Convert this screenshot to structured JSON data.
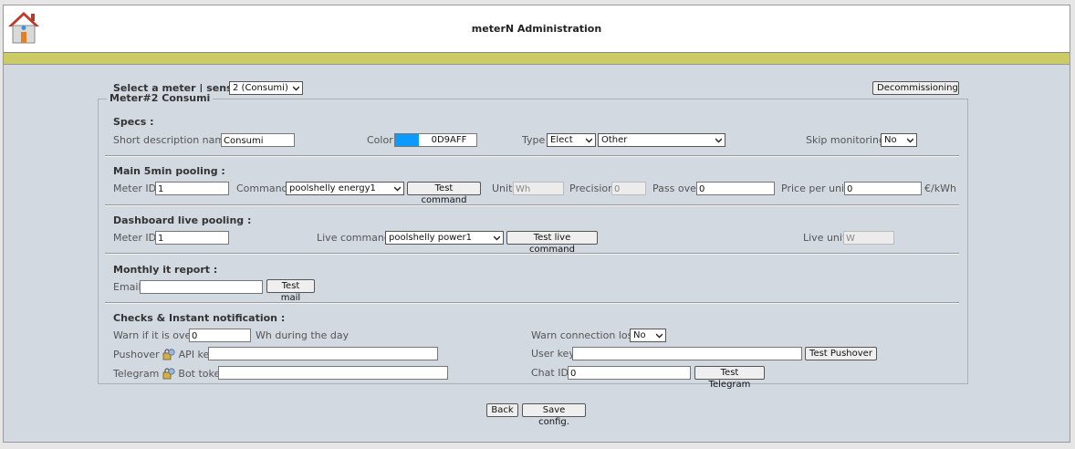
{
  "header": {
    "title": "meterN Administration",
    "home_icon": "home-icon"
  },
  "meter_select": {
    "label": "Select a meter | sensor :",
    "selected": "2 (Consumi)",
    "decommission_label": "Decommissioning"
  },
  "meter_legend": "Meter#2 Consumi",
  "specs": {
    "heading": "Specs :",
    "short_desc_label": "Short description name",
    "short_desc_value": "Consumi",
    "color_label": "Color",
    "color_value": "0D9AFF",
    "color_hex": "#0d9aff",
    "type_label": "Type",
    "type_value": "Elect",
    "subtype_value": "Other",
    "skip_label": "Skip monitoring",
    "skip_value": "No"
  },
  "main_pooling": {
    "heading": "Main 5min pooling :",
    "meter_id_label": "Meter ID",
    "meter_id_value": "1",
    "command_label": "Command",
    "command_value": "poolshelly energy1",
    "test_command_label": "Test command",
    "unit_label": "Unit",
    "unit_value": "Wh",
    "precision_label": "Precision",
    "precision_value": "0",
    "pass_over_label": "Pass over",
    "pass_over_value": "0",
    "price_label": "Price per unit",
    "price_value": "0",
    "price_unit": "€/kWh"
  },
  "live_pooling": {
    "heading": "Dashboard live pooling :",
    "meter_id_label": "Meter ID",
    "meter_id_value": "1",
    "live_command_label": "Live command",
    "live_command_value": "poolshelly power1",
    "test_live_label": "Test live command",
    "live_unit_label": "Live unit",
    "live_unit_value": "W"
  },
  "monthly_report": {
    "heading": "Monthly it report :",
    "email_label": "Email",
    "email_value": "",
    "test_mail_label": "Test mail"
  },
  "notifications": {
    "heading": "Checks & Instant notification :",
    "warn_over_label": "Warn if it is over",
    "warn_over_value": "0",
    "warn_over_suffix": "Wh during the day",
    "warn_conn_label": "Warn connection lost",
    "warn_conn_value": "No",
    "pushover_label": "Pushover",
    "api_key_label": "API key",
    "api_key_value": "",
    "user_key_label": "User key",
    "user_key_value": "",
    "test_pushover_label": "Test Pushover",
    "telegram_label": "Telegram",
    "bot_token_label": "Bot token",
    "bot_token_value": "",
    "chat_id_label": "Chat ID",
    "chat_id_value": "0",
    "test_telegram_label": "Test Telegram"
  },
  "footer": {
    "back_label": "Back",
    "save_label": "Save config."
  }
}
